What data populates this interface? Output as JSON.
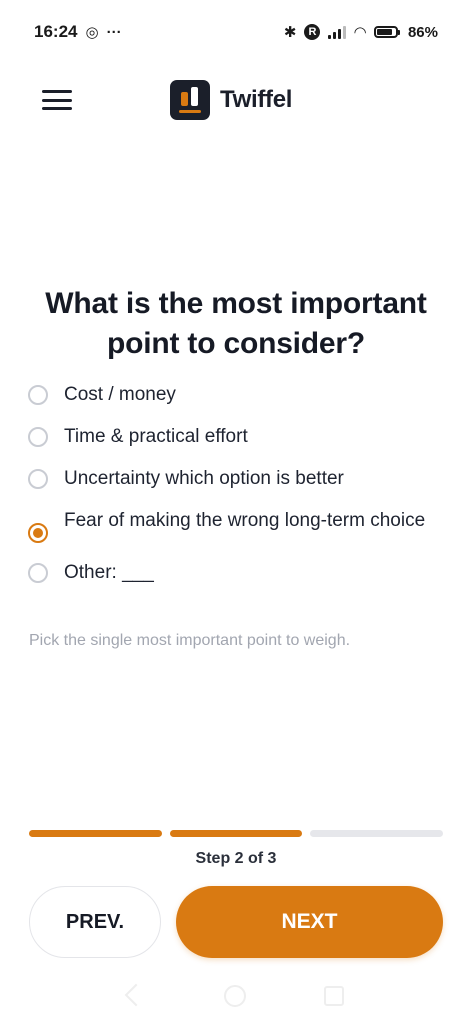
{
  "status_bar": {
    "time": "16:24",
    "instagram_icon": "◎",
    "more_dots": "···",
    "bluetooth_icon": "✱",
    "r_badge": "R",
    "wifi_icon": "◠",
    "battery_percent": "86%",
    "battery_level": 0.86
  },
  "header": {
    "brand_name": "Twiffel"
  },
  "question": {
    "title": "What is the most important point to consider?",
    "options": [
      {
        "label": "Cost / money",
        "selected": false
      },
      {
        "label": "Time & practical effort",
        "selected": false
      },
      {
        "label": "Uncertainty which option is better",
        "selected": false
      },
      {
        "label": "Fear of making the wrong long-term choice",
        "selected": true
      },
      {
        "label": "Other: ___",
        "selected": false
      }
    ],
    "hint": "Pick the single most important point to weigh."
  },
  "progress": {
    "current_step": 2,
    "total_steps": 3,
    "step_text": "Step 2 of 3"
  },
  "nav": {
    "prev_label": "PREV.",
    "next_label": "NEXT"
  },
  "colors": {
    "accent": "#d97a12",
    "text_dark": "#161a25",
    "hint": "#a2a6b0",
    "track": "#e6e7eb"
  }
}
